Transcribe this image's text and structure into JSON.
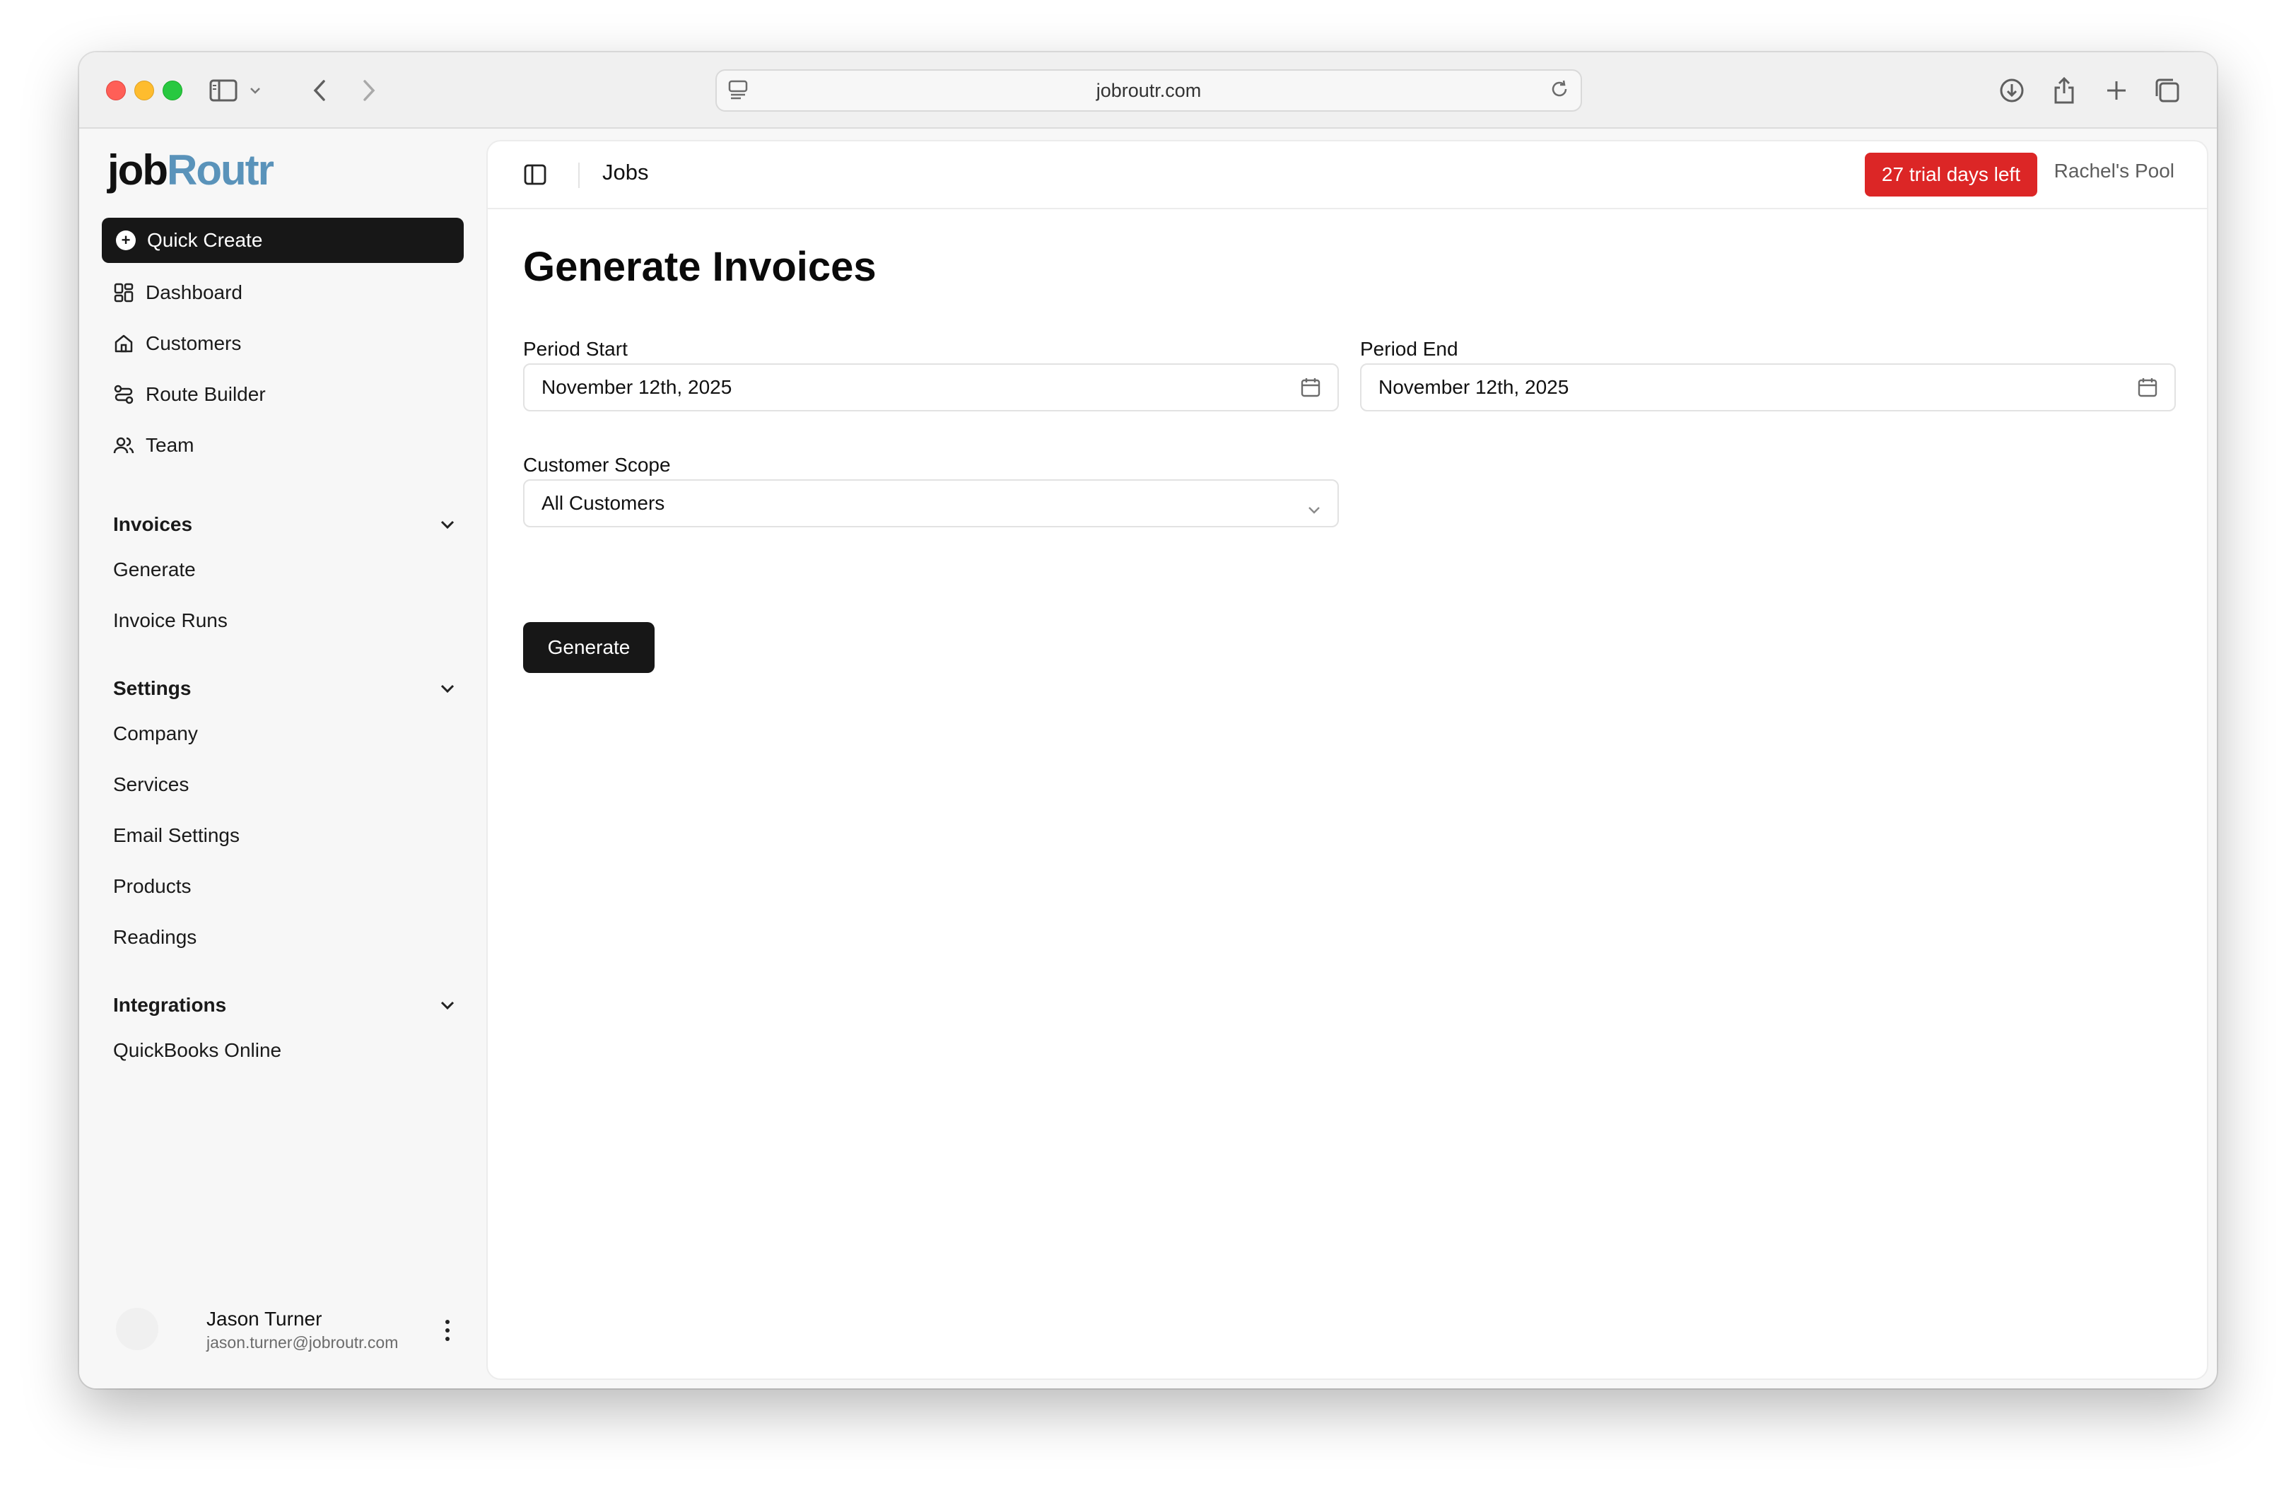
{
  "browser": {
    "url": "jobroutr.com"
  },
  "logo": {
    "part1": "job",
    "part2": "Routr"
  },
  "sidebar": {
    "quick_create": "Quick Create",
    "nav": [
      {
        "label": "Dashboard",
        "icon": "dashboard-icon"
      },
      {
        "label": "Customers",
        "icon": "home-icon"
      },
      {
        "label": "Route Builder",
        "icon": "route-icon"
      },
      {
        "label": "Team",
        "icon": "team-icon"
      }
    ],
    "groups": {
      "invoices": {
        "title": "Invoices",
        "items": [
          "Generate",
          "Invoice Runs"
        ]
      },
      "settings": {
        "title": "Settings",
        "items": [
          "Company",
          "Services",
          "Email Settings",
          "Products",
          "Readings"
        ]
      },
      "integrations": {
        "title": "Integrations",
        "items": [
          "QuickBooks Online"
        ]
      }
    },
    "user": {
      "name": "Jason Turner",
      "email": "jason.turner@jobroutr.com"
    }
  },
  "header": {
    "title": "Jobs",
    "trial_badge": "27 trial days left",
    "account": "Rachel's Pool"
  },
  "form": {
    "title": "Generate Invoices",
    "period_start": {
      "label": "Period Start",
      "value": "November 12th, 2025"
    },
    "period_end": {
      "label": "Period End",
      "value": "November 12th, 2025"
    },
    "customer_scope": {
      "label": "Customer Scope",
      "value": "All Customers"
    },
    "submit": "Generate"
  },
  "colors": {
    "accent_dark": "#171717",
    "trial_red": "#dc2626",
    "logo_blue": "#5a93ba"
  }
}
